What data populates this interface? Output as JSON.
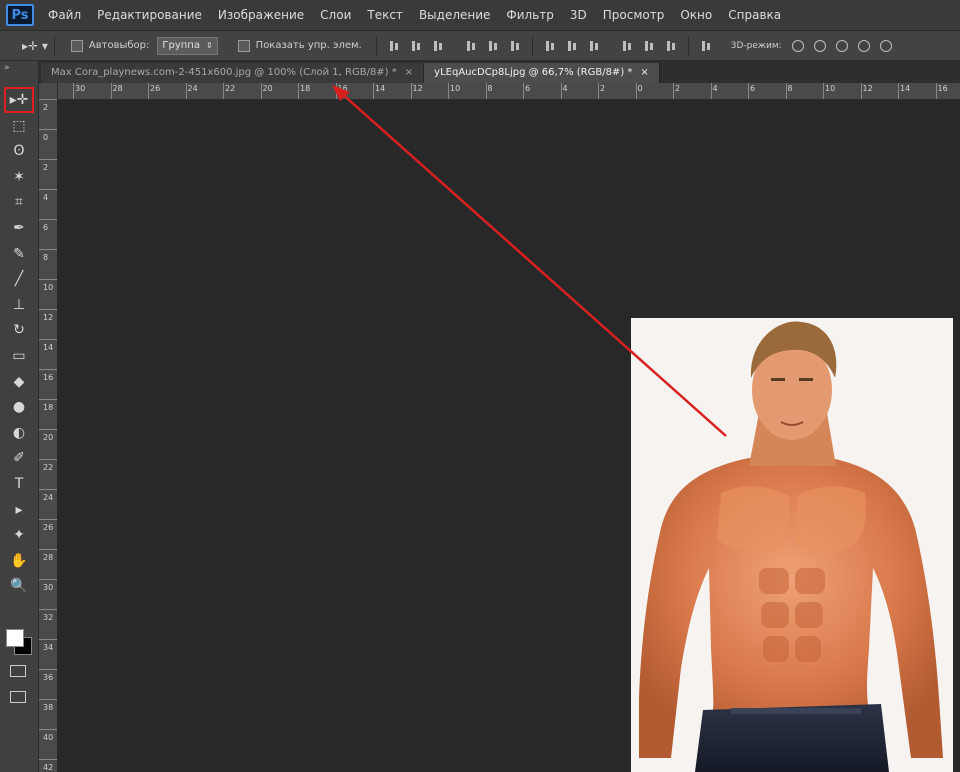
{
  "app": {
    "logo": "Ps"
  },
  "menu": [
    "Файл",
    "Редактирование",
    "Изображение",
    "Слои",
    "Текст",
    "Выделение",
    "Фильтр",
    "3D",
    "Просмотр",
    "Окно",
    "Справка"
  ],
  "options": {
    "autoselect_label": "Автовыбор:",
    "autoselect_value": "Группа",
    "show_controls_label": "Показать упр. элем.",
    "mode3d_label": "3D-режим:"
  },
  "tabs": [
    {
      "title": "Max Cora_playnews.com-2-451x600.jpg @ 100% (Слой 1, RGB/8#) *",
      "close": "×",
      "active": false
    },
    {
      "title": "yLEqAucDCp8Ljpg @ 66,7% (RGB/8#) *",
      "close": "×",
      "active": true
    }
  ],
  "ruler_h": [
    "30",
    "28",
    "26",
    "24",
    "22",
    "20",
    "18",
    "16",
    "14",
    "12",
    "10",
    "8",
    "6",
    "4",
    "2",
    "0",
    "2",
    "4",
    "6",
    "8",
    "10",
    "12",
    "14",
    "16"
  ],
  "ruler_v": [
    "2",
    "0",
    "2",
    "4",
    "6",
    "8",
    "10",
    "12",
    "14",
    "16",
    "18",
    "20",
    "22",
    "24",
    "26",
    "28",
    "30",
    "32",
    "34",
    "36",
    "38",
    "40",
    "42"
  ],
  "tools": [
    "move-tool",
    "marquee-tool",
    "lasso-tool",
    "magic-wand-tool",
    "crop-tool",
    "eyedropper-tool",
    "healing-brush-tool",
    "brush-tool",
    "clone-stamp-tool",
    "history-brush-tool",
    "eraser-tool",
    "paint-bucket-tool",
    "blur-tool",
    "dodge-tool",
    "pen-tool",
    "type-tool",
    "path-selection-tool",
    "shape-tool",
    "hand-tool",
    "zoom-tool"
  ],
  "tool_glyphs": [
    "▸✛",
    "⬚",
    "ʘ",
    "✶",
    "⌗",
    "✒",
    "✎",
    "╱",
    "⊥",
    "↻",
    "▭",
    "◆",
    "●",
    "◐",
    "✐",
    "T",
    "▸",
    "✦",
    "✋",
    "🔍"
  ],
  "colors": {
    "accent_red": "#d82020",
    "foreground": "#ffffff",
    "background": "#000000"
  }
}
